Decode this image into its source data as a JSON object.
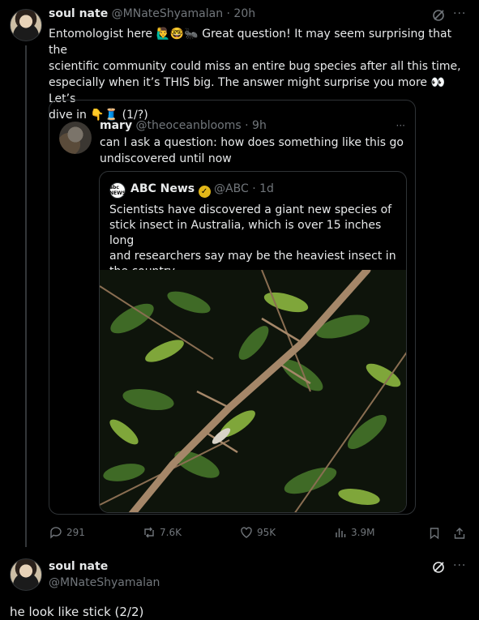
{
  "tweet1": {
    "name": "soul nate",
    "handle": "@MNateShyamalan",
    "time": "· 20h",
    "text_lines": [
      "Entomologist here",
      "Great question! It may seem surprising that the",
      "scientific community could miss an entire bug species after all this time,",
      "especially when it’s THIS big. The answer might surprise you more",
      "Let’s",
      "dive in",
      "(1/?)"
    ],
    "emoji": [
      "🙋‍♂️",
      "🤓",
      "🐜",
      "👀",
      "👇",
      "🧵"
    ]
  },
  "quote": {
    "name": "mary",
    "handle": "@theoceanblooms",
    "time": "· 9h",
    "text_lines": [
      "can I ask a question: how does something like this go",
      "undiscovered until now"
    ],
    "inner": {
      "name": "ABC News",
      "logo_text": "abc NEWS",
      "handle": "@ABC",
      "time": "· 1d",
      "text_lines": [
        "Scientists have discovered a giant new species of",
        "stick insect in Australia, which is over 15 inches long",
        "and researchers say may be the heaviest insect in",
        "the country."
      ]
    }
  },
  "actions": {
    "replies": "291",
    "reposts": "7.6K",
    "likes": "95K",
    "views": "3.9M"
  },
  "tweet2": {
    "name": "soul nate",
    "handle": "@MNateShyamalan",
    "text": "he look like stick (2/2)"
  },
  "more_label": "···",
  "colors": {
    "bg": "#000000",
    "text": "#e7e9ea",
    "muted": "#71767b",
    "border": "#2f3336",
    "verified": "#e2b719"
  }
}
